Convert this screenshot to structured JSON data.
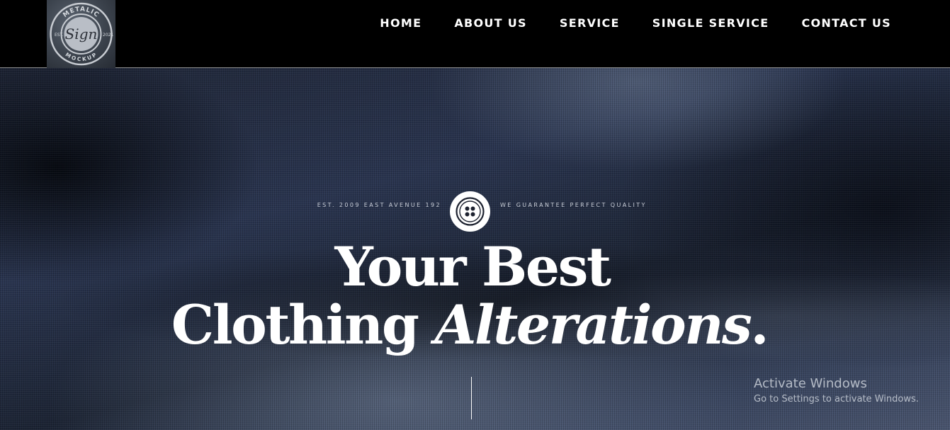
{
  "header": {
    "logo": {
      "top_text": "METALIC",
      "center_text": "Sign",
      "bottom_text": "MOCKUP",
      "left_text": "EST.",
      "right_text": "2021"
    },
    "nav": [
      {
        "label": "HOME"
      },
      {
        "label": "ABOUT US"
      },
      {
        "label": "SERVICE"
      },
      {
        "label": "SINGLE SERVICE"
      },
      {
        "label": "CONTACT US"
      }
    ]
  },
  "hero": {
    "tagline_left": "EST. 2009 EAST AVENUE 192",
    "tagline_right": "WE GUARANTEE PERFECT QUALITY",
    "headline_line1": "Your Best",
    "headline_line2_plain": "Clothing",
    "headline_line2_italic": "Alterations",
    "headline_period": "."
  },
  "watermark": {
    "title": "Activate Windows",
    "subtitle": "Go to Settings to activate Windows."
  },
  "colors": {
    "header_bg": "#000000",
    "nav_text": "#ffffff",
    "hero_fabric": "#232c40"
  },
  "icons": {
    "badge": "button-icon"
  }
}
